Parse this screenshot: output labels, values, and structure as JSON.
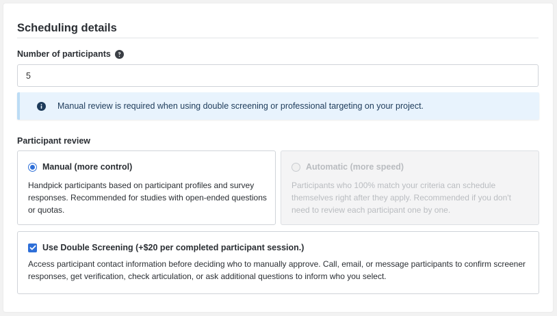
{
  "section": {
    "title": "Scheduling details"
  },
  "participants": {
    "label": "Number of participants",
    "value": "5",
    "help_icon": "question-circle-icon"
  },
  "notice": {
    "icon": "info-circle-icon",
    "text": "Manual review is required when using double screening or professional targeting on your project."
  },
  "review": {
    "label": "Participant review",
    "manual": {
      "title": "Manual (more control)",
      "description": "Handpick participants based on participant profiles and survey responses. Recommended for studies with open-ended questions or quotas.",
      "selected": true
    },
    "automatic": {
      "title": "Automatic (more speed)",
      "description": "Participants who 100% match your criteria can schedule themselves right after they apply. Recommended if you don't need to review each participant one by one.",
      "disabled": true
    }
  },
  "double_screening": {
    "title": "Use Double Screening (+$20 per completed participant session.)",
    "description": "Access participant contact information before deciding who to manually approve. Call, email, or message participants to confirm screener responses, get verification, check articulation, or ask additional questions to inform who you select.",
    "checked": true
  },
  "colors": {
    "accent": "#2e6fd8",
    "notice_bg": "#e8f3fd",
    "notice_text": "#1d3b5a"
  }
}
